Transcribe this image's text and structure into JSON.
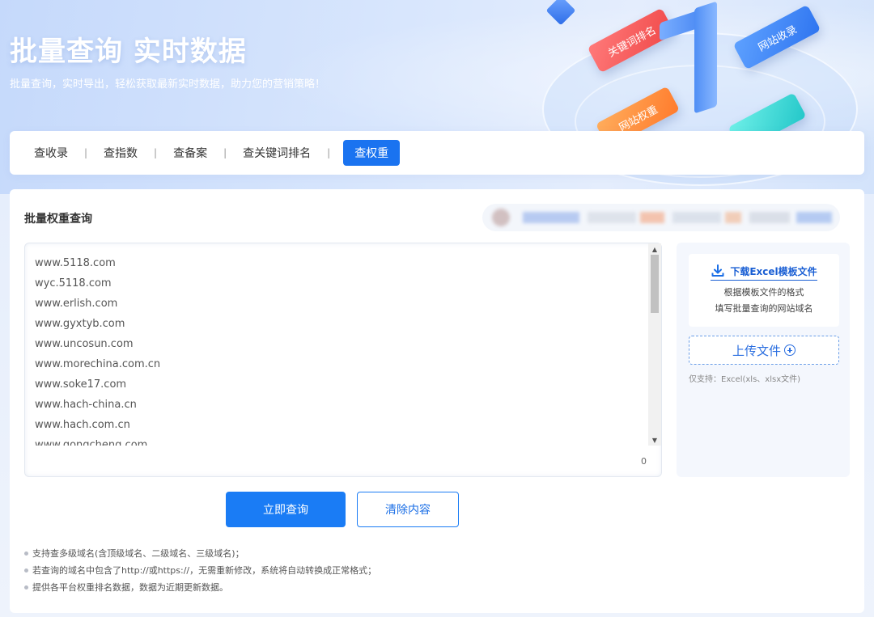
{
  "hero": {
    "title": "批量查询 实时数据",
    "subtitle": "批量查询，实时导出，轻松获取最新实时数据，助力您的营销策略！",
    "decor_labels": [
      "关键词排名",
      "网站收录",
      "网站权重"
    ]
  },
  "tabs": [
    {
      "label": "查收录",
      "active": false
    },
    {
      "label": "查指数",
      "active": false
    },
    {
      "label": "查备案",
      "active": false
    },
    {
      "label": "查关键词排名",
      "active": false
    },
    {
      "label": "查权重",
      "active": true
    }
  ],
  "tab_separator": "|",
  "panel": {
    "title": "批量权重查询",
    "domains": [
      "www.5118.com",
      "wyc.5118.com",
      "www.erlish.com",
      "www.gyxtyb.com",
      "www.uncosun.com",
      "www.morechina.com.cn",
      "www.soke17.com",
      "www.hach-china.cn",
      "www.hach.com.cn",
      "www.gongcheng.com"
    ],
    "char_count": "0"
  },
  "side": {
    "download_label": "下载Excel模板文件",
    "download_desc_1": "根据模板文件的格式",
    "download_desc_2": "填写批量查询的网站域名",
    "upload_label": "上传文件",
    "upload_hint": "仅支持：Excel(xls、xlsx文件)"
  },
  "buttons": {
    "query": "立即查询",
    "clear": "清除内容"
  },
  "notes": [
    "支持查多级域名(含顶级域名、二级域名、三级域名)；",
    "若查询的域名中包含了http://或https://，无需重新修改，系统将自动转换成正常格式；",
    "提供各平台权重排名数据，数据为近期更新数据。"
  ],
  "colors": {
    "primary": "#1a7cf5",
    "active_tab": "#1a73f0"
  }
}
